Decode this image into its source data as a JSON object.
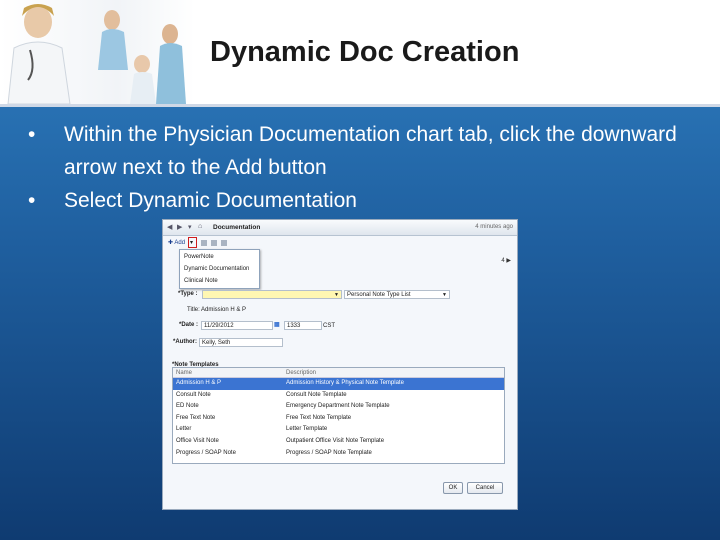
{
  "slide": {
    "title": "Dynamic Doc Creation",
    "bullets": [
      "Within the Physician Documentation chart tab, click the downward arrow next to the Add button",
      "Select Dynamic Documentation"
    ],
    "bullet_glyph": "•"
  },
  "window": {
    "title": "Documentation",
    "updated": "4 minutes ago",
    "add_label": "Add",
    "pager": "4 ▶",
    "menu_items": [
      "PowerNote",
      "Dynamic Documentation",
      "Clinical Note"
    ],
    "type_label": "*Type :",
    "type_value": "",
    "note_type_list": "Personal Note Type List",
    "title_label": "Title:",
    "title_value": "Admission H & P",
    "date_label": "*Date :",
    "date_value": "11/29/2012",
    "time_value": "1333",
    "tz": "CST",
    "author_label": "*Author:",
    "author_value": "Kelly, Seth",
    "templates_label": "*Note Templates",
    "col_name": "Name",
    "col_desc": "Description",
    "templates": [
      {
        "name": "Admission H & P",
        "desc": "Admission History & Physical Note Template"
      },
      {
        "name": "Consult Note",
        "desc": "Consult Note Template"
      },
      {
        "name": "ED Note",
        "desc": "Emergency Department Note Template"
      },
      {
        "name": "Free Text Note",
        "desc": "Free Text Note Template"
      },
      {
        "name": "Letter",
        "desc": "Letter Template"
      },
      {
        "name": "Office Visit Note",
        "desc": "Outpatient Office Visit Note Template"
      },
      {
        "name": "Progress / SOAP Note",
        "desc": "Progress / SOAP Note Template"
      }
    ],
    "selected_index": 0,
    "ok_label": "OK",
    "cancel_label": "Cancel"
  },
  "colors": {
    "background_top": "#2f7fc2",
    "background_bottom": "#0f3b71",
    "selection": "#3b74d2",
    "highlight_box": "#d01c1c"
  }
}
